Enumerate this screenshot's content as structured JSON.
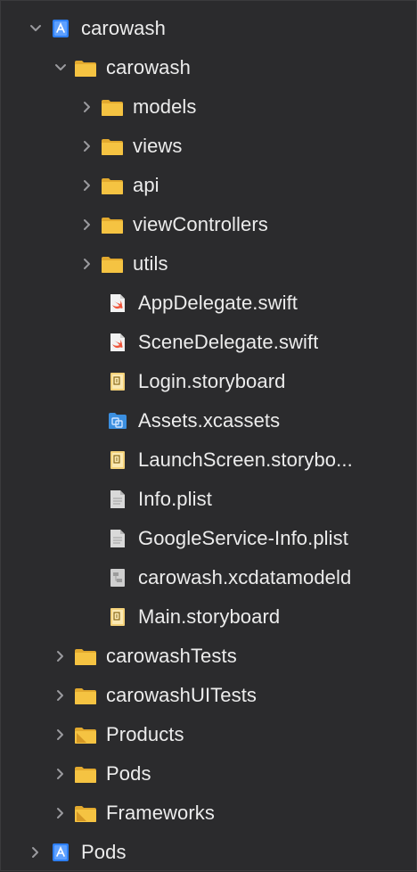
{
  "navigator": {
    "items": [
      {
        "label": "carowash",
        "level": 0,
        "kind": "project",
        "disclosure": "open"
      },
      {
        "label": "carowash",
        "level": 1,
        "kind": "folder",
        "disclosure": "open"
      },
      {
        "label": "models",
        "level": 2,
        "kind": "folder",
        "disclosure": "closed"
      },
      {
        "label": "views",
        "level": 2,
        "kind": "folder",
        "disclosure": "closed"
      },
      {
        "label": "api",
        "level": 2,
        "kind": "folder",
        "disclosure": "closed"
      },
      {
        "label": "viewControllers",
        "level": 2,
        "kind": "folder",
        "disclosure": "closed"
      },
      {
        "label": "utils",
        "level": 2,
        "kind": "folder",
        "disclosure": "closed"
      },
      {
        "label": "AppDelegate.swift",
        "level": 2,
        "kind": "swift",
        "disclosure": "none"
      },
      {
        "label": "SceneDelegate.swift",
        "level": 2,
        "kind": "swift",
        "disclosure": "none"
      },
      {
        "label": "Login.storyboard",
        "level": 2,
        "kind": "storyboard",
        "disclosure": "none"
      },
      {
        "label": "Assets.xcassets",
        "level": 2,
        "kind": "assets",
        "disclosure": "none"
      },
      {
        "label": "LaunchScreen.storybo...",
        "level": 2,
        "kind": "storyboard",
        "disclosure": "none"
      },
      {
        "label": "Info.plist",
        "level": 2,
        "kind": "plist",
        "disclosure": "none"
      },
      {
        "label": "GoogleService-Info.plist",
        "level": 2,
        "kind": "plist",
        "disclosure": "none"
      },
      {
        "label": "carowash.xcdatamodeld",
        "level": 2,
        "kind": "datamodel",
        "disclosure": "none"
      },
      {
        "label": "Main.storyboard",
        "level": 2,
        "kind": "storyboard",
        "disclosure": "none"
      },
      {
        "label": "carowashTests",
        "level": 1,
        "kind": "folder",
        "disclosure": "closed"
      },
      {
        "label": "carowashUITests",
        "level": 1,
        "kind": "folder",
        "disclosure": "closed"
      },
      {
        "label": "Products",
        "level": 1,
        "kind": "group-folder",
        "disclosure": "closed"
      },
      {
        "label": "Pods",
        "level": 1,
        "kind": "folder",
        "disclosure": "closed"
      },
      {
        "label": "Frameworks",
        "level": 1,
        "kind": "group-folder",
        "disclosure": "closed"
      },
      {
        "label": "Pods",
        "level": 0,
        "kind": "project",
        "disclosure": "closed"
      }
    ]
  },
  "colors": {
    "background": "#2b2b2d",
    "text": "#ececec",
    "folder": "#f5c342",
    "project_blue": "#2d7ff5",
    "swift_red": "#f0553a",
    "chevron": "#9a9a9e"
  },
  "icons": {
    "project": "xcode-project-icon",
    "folder": "folder-icon",
    "group-folder": "group-folder-icon",
    "swift": "swift-file-icon",
    "storyboard": "storyboard-file-icon",
    "assets": "asset-catalog-icon",
    "plist": "plist-file-icon",
    "datamodel": "data-model-icon"
  }
}
